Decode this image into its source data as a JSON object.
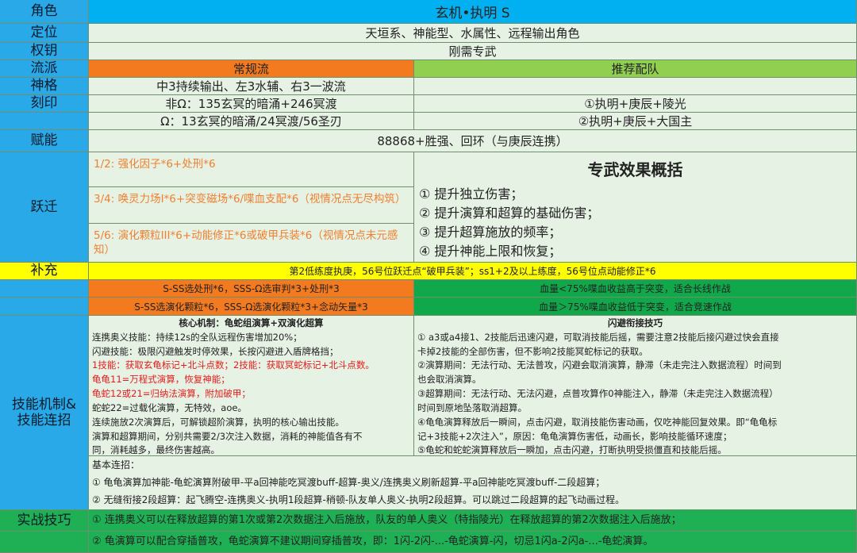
{
  "header": {
    "role_label": "角色",
    "role_value": "玄机•执明 S",
    "position_label": "定位",
    "position_value": "天垣系、神能型、水属性、远程输出角色",
    "key_label": "权钥",
    "key_value": "刚需专武",
    "school_label": "流派",
    "school_regular": "常规流",
    "school_team": "推荐配队"
  },
  "divinity": {
    "label": "神格",
    "value": "中3持续输出、左3水辅、右3一波流"
  },
  "imprint": {
    "label": "刻印",
    "row1": "非Ω：135玄冥的暗涌+246冥渡",
    "row2": "Ω：13玄冥的暗涌/24冥渡/56圣刃",
    "team1": "①执明+庚辰+陵光",
    "team2": "②执明+庚辰+大国主"
  },
  "talent": {
    "label": "赋能",
    "value": "88868+胜强、回环（与庚辰连携）"
  },
  "leap": {
    "label": "跃迁",
    "items": [
      "1/2:   强化因子*6+处刑*6",
      "3/4:   唤灵力场I*6+突变磁场*6/喋血支配*6（视情况点无尽构筑）",
      "5/6:   演化颗粒III*6+动能修正*6或破甲兵装*6（视情况点未元感知）"
    ],
    "exclusive_title": "专武效果概括",
    "exclusive_items": [
      "① 提升独立伤害；",
      "② 提升演算和超算的基础伤害；",
      "③ 提升超算施放的频率；",
      "④ 提升神能上限和恢复；"
    ]
  },
  "supplement": {
    "label": "补充",
    "value": "第2低练度执庚，56号位跃迁点“破甲兵装”；ss1+2及以上练度，56号位点动能修正*6"
  },
  "options": {
    "left1": "S-SS选处刑*6，SSS-Ω选审判*3+处刑*3",
    "left2": "S-SS选演化颗粒*6，SSS-Ω选演化颗粒*3+念动矢量*3",
    "right1": "血量<75%喋血收益高于突变，适合长线作战",
    "right2": "血量＞75%喋血收益低于突变，适合竞速作战"
  },
  "skills": {
    "label": "技能机制&技能连招",
    "core_title": "核心机制：龟蛇组演算+双演化超算",
    "core_lines": [
      {
        "text": "连携奥义技能：持续12s的全队远程伤害增加20%；",
        "red": false
      },
      {
        "text": "闪避技能：极限闪避触发时停效果，长按闪避进入盾牌格挡；",
        "red": false
      },
      {
        "text": "1技能：获取玄龟标记+北斗点数；2技能：获取冥蛇标记+北斗点数。",
        "red": true
      },
      {
        "text": "龟龟11=万程式演算，恢复神能；",
        "red": true
      },
      {
        "text": "龟蛇12或21=归纳法演算，附加破甲；",
        "red": true
      },
      {
        "text": "蛇蛇22=过载化演算，无特效，aoe。",
        "red": false
      },
      {
        "text": "连续施放2次演算后，可解锁超阶演算，执明的核心输出技能。",
        "red": false
      },
      {
        "text": "演算和超算期间，分别共需要2/3次注入数据，消耗的神能值各有不",
        "red": false
      },
      {
        "text": "同，消耗越多，最终伤害越高。",
        "red": false
      }
    ],
    "dodge_title": "闪避衔接技巧",
    "dodge_lines": [
      "①  a3或a4接1、2技能后迅速闪避，可取消技能后摇，需要注意2技能后接闪避过快会直接",
      "卡掉2技能的全部伤害，但不影响2技能冥蛇标记的获取。",
      "②演算期间：无法行动、无法普攻，闪避会取消演算，静滞（未走完注入数据流程）时间到",
      "也会取消演算。",
      "③超算期间：无法行动、无法闪避，点普攻算作0神能注入，静滞（未走完注入数据流程）",
      "时间到原地坠落取消超算。",
      "④龟龟演算释放后一瞬间，点击闪避，取消技能伤害动画，仅吃神能回复效果。即“龟龟标",
      "记+3技能+2次注入”，原因：龟龟演算伤害低，动画长，影响技能循环速度；",
      "⑤龟蛇和蛇蛇演算释放后一瞬加，点击闪避，打断执明受损僵直和技能后摇。"
    ],
    "combo_title": "基本连招：",
    "combo_lines": [
      "①  龟龟演算加神能-龟蛇演算附破甲-平a回神能吃冥渡buff-超算-奥义/连携奥义刷新超算-平a回神能吃冥渡buff-二段超算；",
      "②  无缝衔接2段超算：起飞腾空-连携奥义-执明1段超算-稍顿-队友单人奥义-执明2段超算。可以跳过二段超算的起飞动画过程。"
    ]
  },
  "tips": {
    "label": "实战技巧",
    "line1": "①  连携奥义可以在释放超算的第1次或第2次数据注入后施放，队友的单人奥义（特指陵光）在释放超算的第2次数据注入后施放；",
    "line2": "②  龟演算可以配合穿插普攻，龟蛇演算不建议期间穿插普攻，即：1闪-2闪-...-龟蛇演算-闪，切忌1闪a-2闪a-...-龟蛇演算。"
  }
}
